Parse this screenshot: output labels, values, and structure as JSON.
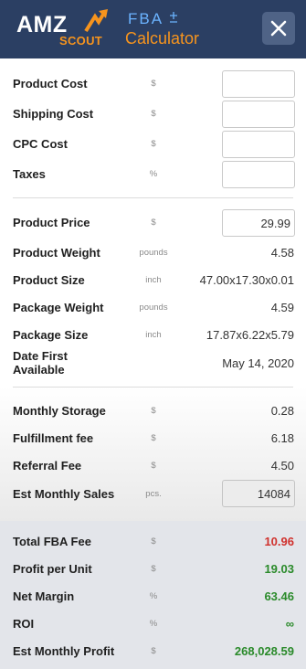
{
  "header": {
    "logo_amz": "AMZ",
    "logo_scout": "SCOUT",
    "logo_fba": "FBA",
    "logo_calc": "Calculator",
    "colors": {
      "bar": "#2b3f63",
      "accent": "#f7941d",
      "fba_blue": "#6bb3ff"
    },
    "close_icon": "close-icon"
  },
  "costs": [
    {
      "label": "Product Cost",
      "unit": "$",
      "value": ""
    },
    {
      "label": "Shipping Cost",
      "unit": "$",
      "value": ""
    },
    {
      "label": "CPC Cost",
      "unit": "$",
      "value": ""
    },
    {
      "label": "Taxes",
      "unit": "%",
      "value": ""
    }
  ],
  "product": {
    "price": {
      "label": "Product Price",
      "unit": "$",
      "value": "29.99"
    },
    "weight": {
      "label": "Product Weight",
      "unit": "pounds",
      "value": "4.58"
    },
    "size": {
      "label": "Product Size",
      "unit": "inch",
      "value": "47.00x17.30x0.01"
    },
    "package_weight": {
      "label": "Package Weight",
      "unit": "pounds",
      "value": "4.59"
    },
    "package_size": {
      "label": "Package Size",
      "unit": "inch",
      "value": "17.87x6.22x5.79"
    },
    "date_label_1": "Date First",
    "date_label_2": "Available",
    "date_value": "May 14, 2020"
  },
  "fees": {
    "storage": {
      "label": "Monthly Storage",
      "unit": "$",
      "value": "0.28"
    },
    "fulfillment": {
      "label": "Fulfillment fee",
      "unit": "$",
      "value": "6.18"
    },
    "referral": {
      "label": "Referral Fee",
      "unit": "$",
      "value": "4.50"
    },
    "sales": {
      "label": "Est Monthly Sales",
      "unit": "pcs.",
      "value": "14084"
    }
  },
  "results": {
    "total_fba": {
      "label": "Total FBA Fee",
      "unit": "$",
      "value": "10.96",
      "color": "#d0312d"
    },
    "profit_unit": {
      "label": "Profit per Unit",
      "unit": "$",
      "value": "19.03",
      "color": "#2a8a2a"
    },
    "net_margin": {
      "label": "Net Margin",
      "unit": "%",
      "value": "63.46",
      "color": "#2a8a2a"
    },
    "roi": {
      "label": "ROI",
      "unit": "%",
      "value": "∞",
      "color": "#2a8a2a"
    },
    "monthly_profit": {
      "label": "Est Monthly Profit",
      "unit": "$",
      "value": "268,028.59",
      "color": "#2a8a2a"
    }
  }
}
